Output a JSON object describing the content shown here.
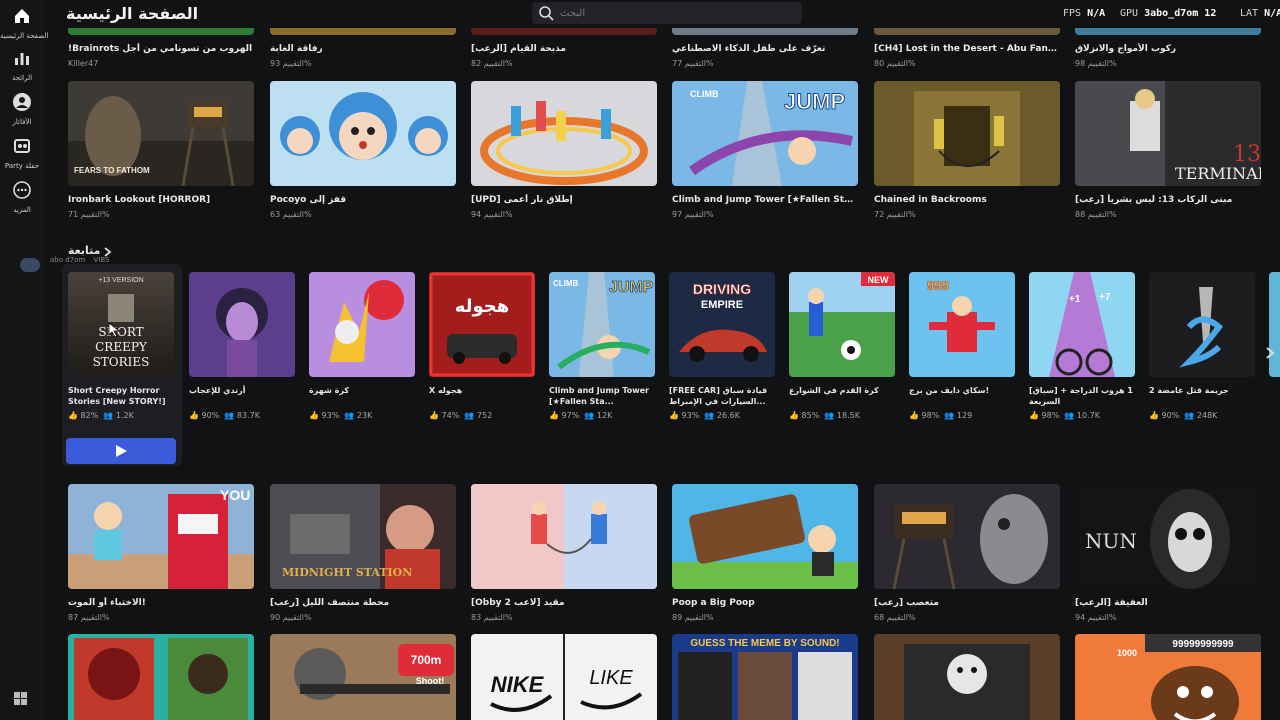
{
  "nav": {
    "home": "الصفحة الرئيسية",
    "charts": "الرائجة",
    "avatar": "الأفاتار",
    "party": "Party حفلة",
    "more": "المزيد"
  },
  "header": {
    "title": "الصفحة الرئيسية",
    "search_placeholder": "البحث",
    "fps_label": "FPS",
    "fps_value": "N/A",
    "gpu_label": "GPU",
    "gpu_value": "3abo_d7om 12",
    "lat_label": "LAT",
    "lat_value": "N/A"
  },
  "row1": [
    {
      "title": "!Brainrots الهروب من تسونامي من أجل",
      "sub": "Killer47"
    },
    {
      "title": "رفاقة الغابة",
      "sub": "التقييم 93%"
    },
    {
      "title": "[الرعب] مذبحة القيام",
      "sub": "التقييم 82%"
    },
    {
      "title": "تعرّف على طفل الذكاء الاصطناعي",
      "sub": "التقييم 77%"
    },
    {
      "title": "[CH4] Lost in the Desert - Abu Fanous",
      "sub": "التقييم 80%"
    },
    {
      "title": "ركوب الأمواج والانزلاق",
      "sub": "التقييم 98%"
    }
  ],
  "row2": [
    {
      "title": "Ironbark Lookout [HORROR]",
      "sub": "التقييم 71%"
    },
    {
      "title": "Pocoyo قفز إلى",
      "sub": "التقييم 63%"
    },
    {
      "title": "[UPD] إطلاق نار أعمى",
      "sub": "التقييم 94%"
    },
    {
      "title": "Climb and Jump Tower [★Fallen Stars]",
      "sub": "التقييم 97%"
    },
    {
      "title": "Chained in Backrooms",
      "sub": "التقييم 72%"
    },
    {
      "title": "مبنى الركاب 13: ليس بشرياً [رعب]",
      "sub": "التقييم 88%"
    }
  ],
  "continue": {
    "heading": "متابعة",
    "friend_name": "abo d7om",
    "friend_tag": "VIBS",
    "play_label": "Play",
    "items": [
      {
        "title": "Short Creepy Horror Stories [New STORY!]",
        "rating": "82%",
        "players": "1.2K"
      },
      {
        "title": "أرتدي للإعجاب",
        "rating": "90%",
        "players": "83.7K"
      },
      {
        "title": "كرة شهرة",
        "rating": "93%",
        "players": "23K"
      },
      {
        "title": "X هجوله",
        "rating": "74%",
        "players": "752"
      },
      {
        "title": "Climb and Jump Tower [★Fallen Sta...",
        "rating": "97%",
        "players": "12K"
      },
      {
        "title": "[FREE CAR] قيادة سباق السيارات في الإمبراط...",
        "rating": "93%",
        "players": "26.6K"
      },
      {
        "title": "كرة القدم في الشوارع",
        "rating": "85%",
        "players": "18.5K"
      },
      {
        "title": "سكاي دايف من برج!",
        "rating": "98%",
        "players": "129"
      },
      {
        "title": "[سباق] + 1 هروب الدراجة السريعة",
        "rating": "98%",
        "players": "10.7K"
      },
      {
        "title": "جريمة قتل غامضة 2",
        "rating": "90%",
        "players": "248K"
      }
    ],
    "badges": {
      "first": "+13 VERSION",
      "new": "NEW"
    }
  },
  "row3": [
    {
      "title": "الاختباء أو الموت!",
      "sub": "التقييم 87%"
    },
    {
      "title": "محطة منتصف الليل [رعب]",
      "sub": "التقييم 90%"
    },
    {
      "title": "[Obby 2 لاعب] مقيد",
      "sub": "التقييم 83%"
    },
    {
      "title": "Poop a Big Poop",
      "sub": "التقييم 89%"
    },
    {
      "title": "متعصب [رعب]",
      "sub": "التقييم 68%"
    },
    {
      "title": "العفيفة [الرعب]",
      "sub": "التقييم 94%"
    }
  ],
  "row4_labels": {
    "shoot": "700m Shoot!",
    "meme": "GUESS THE MEME BY SOUND!",
    "nike": "NIKE",
    "like": "LIKE",
    "count": "99999999999",
    "thousand": "1000"
  }
}
